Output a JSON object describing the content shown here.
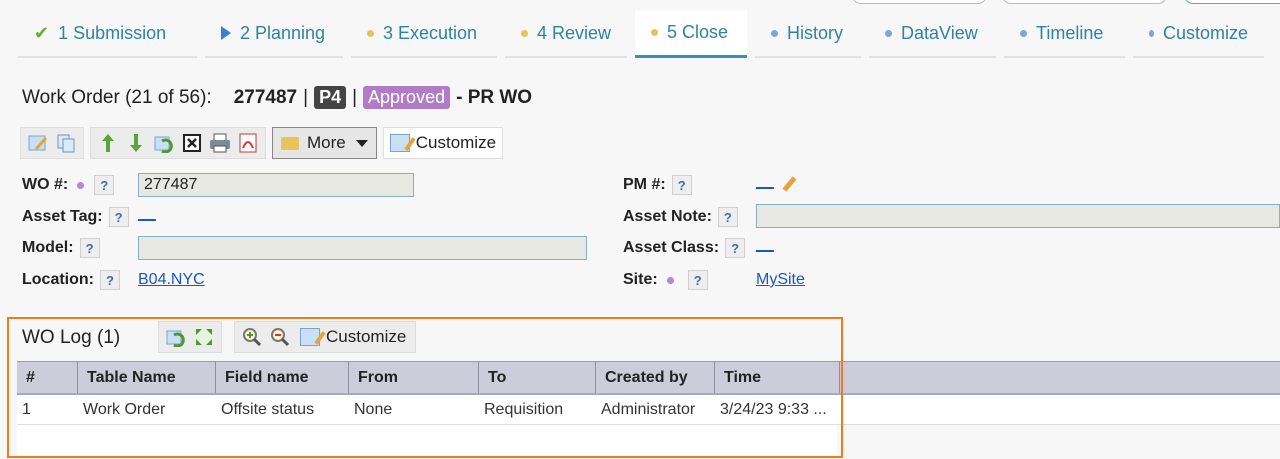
{
  "tabs": [
    {
      "label": "1 Submission",
      "icon": "check-icon"
    },
    {
      "label": "2 Planning",
      "icon": "play-icon"
    },
    {
      "label": "3 Execution",
      "icon": "yellow-dot-icon"
    },
    {
      "label": "4 Review",
      "icon": "yellow-dot-icon"
    },
    {
      "label": "5 Close",
      "icon": "yellow-dot-icon",
      "active": true
    },
    {
      "label": "History",
      "icon": "blue-dot-icon"
    },
    {
      "label": "DataView",
      "icon": "blue-dot-icon"
    },
    {
      "label": "Timeline",
      "icon": "blue-dot-icon"
    },
    {
      "label": "Customize",
      "icon": "blue-dot-icon"
    }
  ],
  "header": {
    "label": "Work Order (21 of 56):",
    "number": "277487",
    "sep1": "|",
    "priority": "P4",
    "sep2": "|",
    "status": "Approved",
    "type": "- PR WO"
  },
  "toolbar": {
    "more_label": "More",
    "customize_label": "Customize"
  },
  "form": {
    "wo_label": "WO #:",
    "wo_value": "277487",
    "asset_tag_label": "Asset Tag:",
    "asset_tag_value": "__",
    "model_label": "Model:",
    "model_value": "",
    "location_label": "Location:",
    "location_value": "B04.NYC",
    "pm_label": "PM #:",
    "pm_value": "__",
    "asset_note_label": "Asset Note:",
    "asset_note_value": "",
    "asset_class_label": "Asset Class:",
    "asset_class_value": "__",
    "site_label": "Site:",
    "site_value": "MySite",
    "help": "?"
  },
  "log": {
    "title": "WO Log (1)",
    "customize_label": "Customize",
    "columns": [
      "#",
      "Table Name",
      "Field name",
      "From",
      "To",
      "Created by",
      "Time"
    ],
    "rows": [
      [
        "1",
        "Work Order",
        "Offsite status",
        "None",
        "Requisition",
        "Administrator",
        "3/24/23 9:33 ..."
      ]
    ]
  },
  "colors": {
    "accent": "#3a8fb7",
    "status_badge": "#b07cc6",
    "priority_badge": "#444444",
    "highlight_border": "#f07a1c",
    "link": "#1a56c4"
  }
}
